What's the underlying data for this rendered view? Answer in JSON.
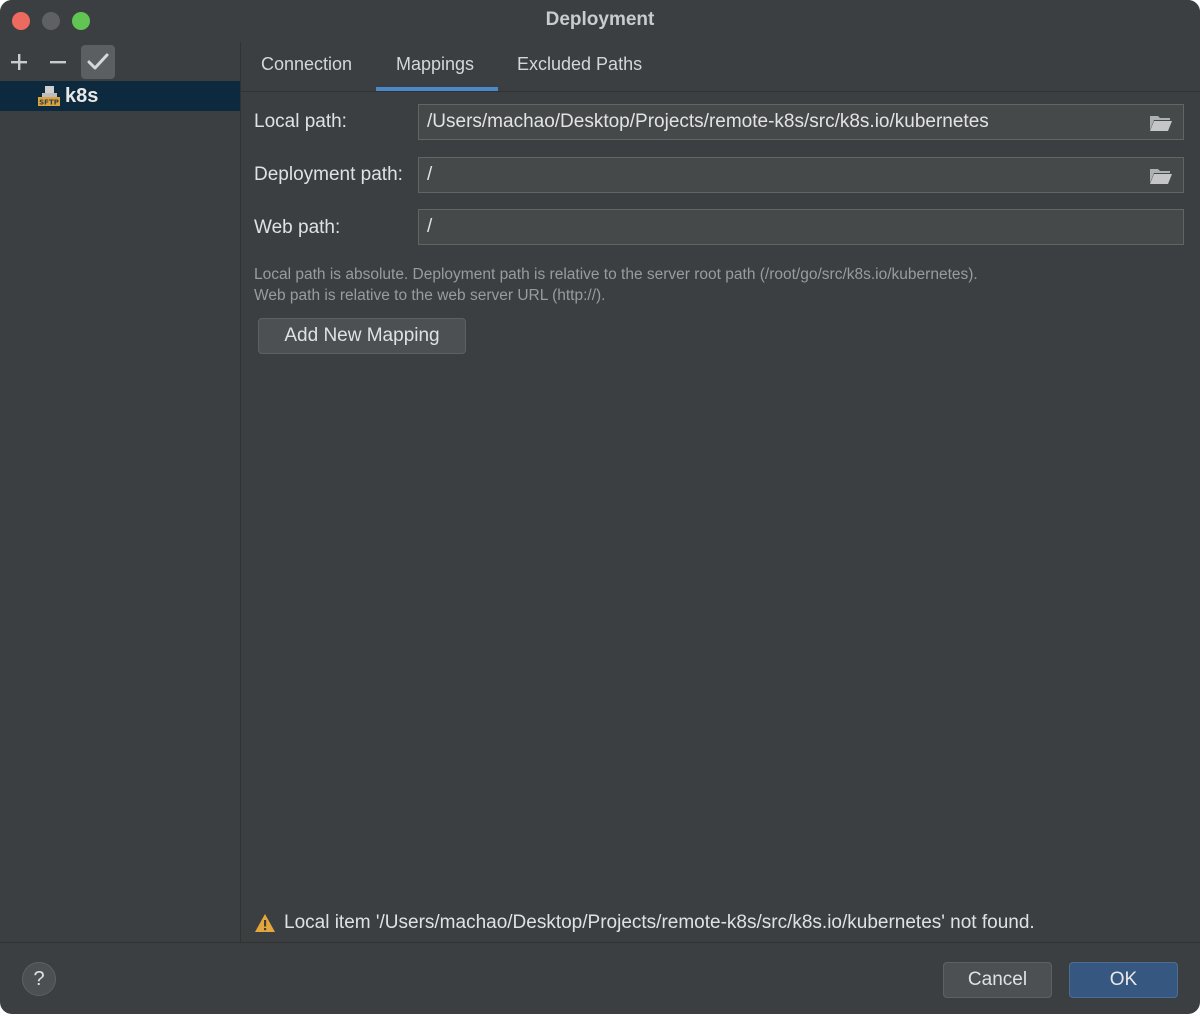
{
  "window": {
    "title": "Deployment"
  },
  "sidebar": {
    "toolbar": {
      "add": "+",
      "remove": "−",
      "check": "✓"
    },
    "items": [
      {
        "label": "k8s",
        "icon": "sftp-server-icon",
        "selected": true
      }
    ]
  },
  "tabs": [
    {
      "label": "Connection"
    },
    {
      "label": "Mappings",
      "active": true
    },
    {
      "label": "Excluded Paths"
    }
  ],
  "form": {
    "local_path": {
      "label": "Local path:",
      "value": "/Users/machao/Desktop/Projects/remote-k8s/src/k8s.io/kubernetes"
    },
    "deployment_path": {
      "label": "Deployment path:",
      "value": "/"
    },
    "web_path": {
      "label": "Web path:",
      "value": "/"
    },
    "hint_line1": "Local path is absolute. Deployment path is relative to the server root path (/root/go/src/k8s.io/kubernetes).",
    "hint_line2": "Web path is relative to the web server URL (http://).",
    "add_mapping_label": "Add New Mapping"
  },
  "status": {
    "warning": "Local item '/Users/machao/Desktop/Projects/remote-k8s/src/k8s.io/kubernetes' not found."
  },
  "footer": {
    "help": "?",
    "cancel_label": "Cancel",
    "ok_label": "OK"
  },
  "colors": {
    "background": "#3c3f41",
    "selection": "#0d293e",
    "accent": "#4a88c7",
    "primary_button": "#365880",
    "warning": "#e3a73c"
  }
}
